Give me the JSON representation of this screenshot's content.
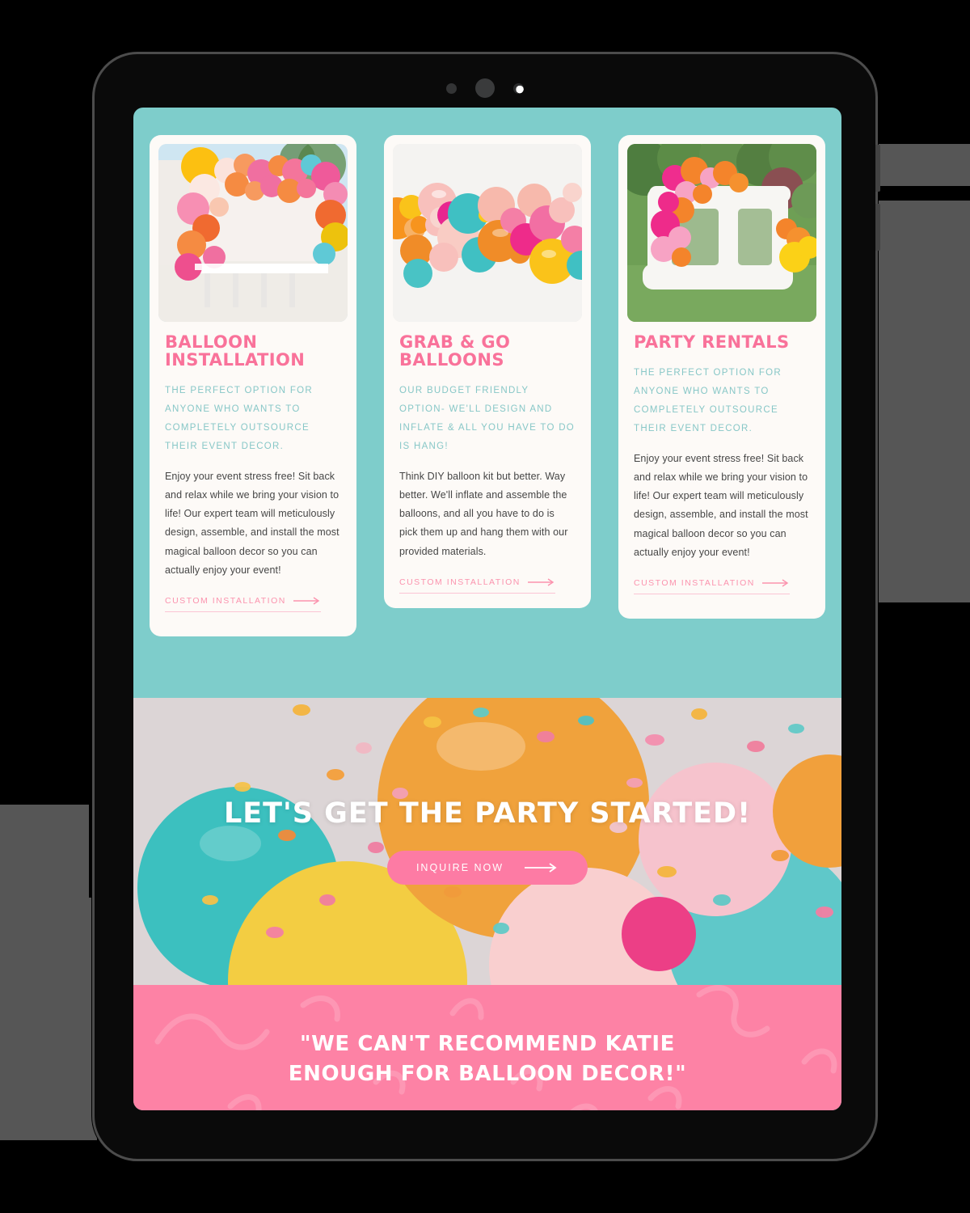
{
  "device": {
    "sensors": [
      "proximity-sensor",
      "speaker-sensor",
      "front-camera-lens"
    ],
    "frame_color": "#0a0a0a",
    "screen_bg": "#7ecdcb"
  },
  "theme": {
    "teal": "#7ecdcb",
    "pink": "#fd82a5",
    "hot_pink": "#f9729a",
    "link_pink": "#fb93ae",
    "card_bg": "#fdfaf7",
    "sub_teal": "#87c7c7",
    "body_text": "#464646"
  },
  "cards": [
    {
      "title": "BALLOON INSTALLATION",
      "subtitle": "THE PERFECT OPTION FOR ANYONE WHO WANTS TO COMPLETELY OUTSOURCE THEIR EVENT DECOR.",
      "body": "Enjoy your event stress free! Sit back and relax while we bring your vision to life! Our expert team will meticulously design, assemble, and install the most magical balloon decor so you can actually enjoy your event!",
      "link_label": "CUSTOM INSTALLATION",
      "image_alt": "balloon-arch-over-dessert-table"
    },
    {
      "title": "GRAB & GO BALLOONS",
      "subtitle": "OUR BUDGET FRIENDLY OPTION- WE'LL DESIGN AND INFLATE & ALL YOU HAVE TO DO IS HANG!",
      "body": "Think DIY balloon kit but better. Way better. We'll inflate and assemble the balloons, and all you have to do is pick them up and hang them with our provided materials.",
      "link_label": "CUSTOM INSTALLATION",
      "image_alt": "balloon-garland-on-white-wall"
    },
    {
      "title": "PARTY RENTALS",
      "subtitle": "THE PERFECT OPTION FOR ANYONE WHO WANTS TO COMPLETELY OUTSOURCE THEIR EVENT DECOR.",
      "body": "Enjoy your event stress free! Sit back and relax while we bring your vision to life! Our expert team will meticulously design, assemble, and install the most magical balloon decor so you can actually enjoy your event!",
      "link_label": "CUSTOM INSTALLATION",
      "image_alt": "white-bounce-house-with-balloon-garland"
    }
  ],
  "hero": {
    "title": "LET'S GET THE PARTY STARTED!",
    "cta_label": "INQUIRE NOW",
    "image_alt": "confetti-balloons-closeup"
  },
  "testimonial": {
    "line1": "\"WE CAN'T RECOMMEND KATIE",
    "line2": "ENOUGH FOR BALLOON DECOR!\""
  }
}
